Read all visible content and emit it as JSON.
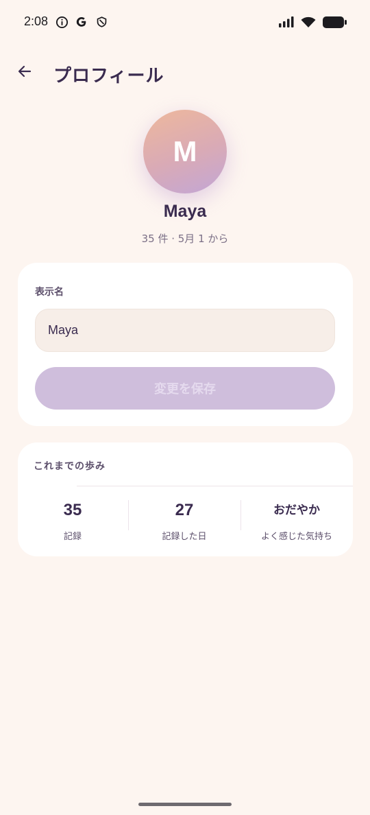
{
  "status_bar": {
    "time": "2:08",
    "left_icons": [
      "info-icon",
      "google-icon",
      "shield-icon"
    ],
    "right_icons": [
      "signal-icon",
      "wifi-icon",
      "battery-icon"
    ]
  },
  "app_bar": {
    "back_icon": "arrow-left-icon",
    "title": "プロフィール"
  },
  "profile": {
    "initial": "M",
    "name": "Maya",
    "meta": "35 件 · 5月 1 から"
  },
  "name_card": {
    "label": "表示名",
    "input_value": "Maya",
    "input_placeholder": "",
    "save_label": "変更を保存"
  },
  "stats_card": {
    "title": "これまでの歩み",
    "stats": [
      {
        "value": "35",
        "label": "記録"
      },
      {
        "value": "27",
        "label": "記録した日"
      },
      {
        "value": "おだやか",
        "label": "よく感じた気持ち"
      }
    ]
  },
  "colors": {
    "background": "#fdf5f0",
    "card": "#ffffff",
    "primary_text": "#3a2b4f",
    "button_disabled": "#cfbedc",
    "avatar_gradient": [
      "#eeb89c",
      "#c2a6d6"
    ]
  }
}
